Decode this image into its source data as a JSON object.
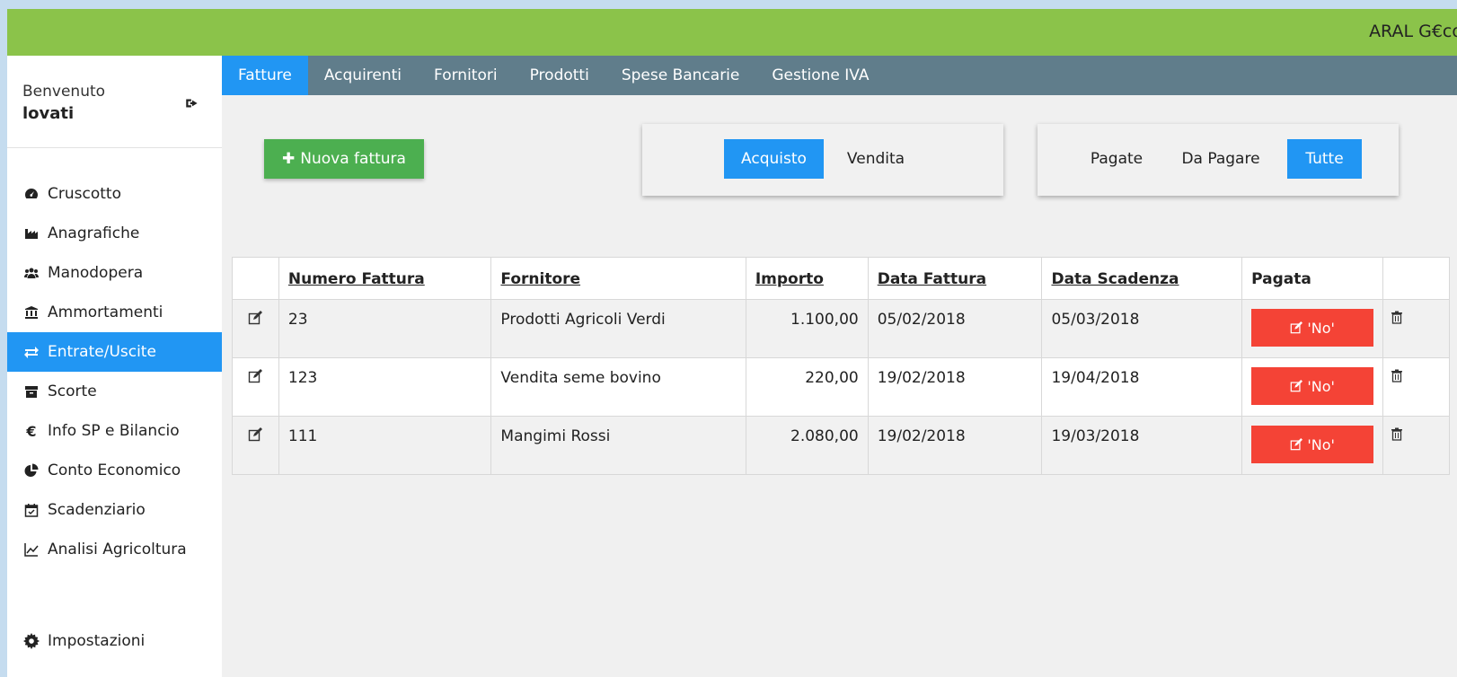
{
  "app": {
    "brand": "ARAL G€co"
  },
  "user": {
    "welcome": "Benvenuto",
    "name": "lovati"
  },
  "sidebar": {
    "items": [
      {
        "label": "Cruscotto",
        "icon": "dashboard-icon"
      },
      {
        "label": "Anagrafiche",
        "icon": "industry-icon"
      },
      {
        "label": "Manodopera",
        "icon": "users-icon"
      },
      {
        "label": "Ammortamenti",
        "icon": "bank-icon"
      },
      {
        "label": "Entrate/Uscite",
        "icon": "exchange-icon",
        "active": true
      },
      {
        "label": "Scorte",
        "icon": "archive-icon"
      },
      {
        "label": "Info SP e Bilancio",
        "icon": "euro-icon"
      },
      {
        "label": "Conto Economico",
        "icon": "pie-chart-icon"
      },
      {
        "label": "Scadenziario",
        "icon": "calendar-check-icon"
      },
      {
        "label": "Analisi Agricoltura",
        "icon": "line-chart-icon"
      }
    ],
    "settings": {
      "label": "Impostazioni",
      "icon": "gear-icon"
    }
  },
  "tabs": [
    {
      "label": "Fatture",
      "active": true
    },
    {
      "label": "Acquirenti"
    },
    {
      "label": "Fornitori"
    },
    {
      "label": "Prodotti"
    },
    {
      "label": "Spese Bancarie"
    },
    {
      "label": "Gestione IVA"
    }
  ],
  "actions": {
    "new_invoice": "Nuova fattura"
  },
  "type_filter": {
    "purchase": "Acquisto",
    "sale": "Vendita",
    "selected": "Acquisto"
  },
  "payment_filter": {
    "paid": "Pagate",
    "to_pay": "Da Pagare",
    "all": "Tutte",
    "selected": "Tutte"
  },
  "table": {
    "headers": {
      "number": "Numero Fattura",
      "supplier": "Fornitore",
      "amount": "Importo",
      "invoice_date": "Data Fattura",
      "due_date": "Data Scadenza",
      "paid": "Pagata"
    },
    "rows": [
      {
        "number": "23",
        "supplier": "Prodotti Agricoli Verdi",
        "amount": "1.100,00",
        "invoice_date": "05/02/2018",
        "due_date": "05/03/2018",
        "paid": "'No'"
      },
      {
        "number": "123",
        "supplier": "Vendita seme bovino",
        "amount": "220,00",
        "invoice_date": "19/02/2018",
        "due_date": "19/04/2018",
        "paid": "'No'"
      },
      {
        "number": "111",
        "supplier": "Mangimi Rossi",
        "amount": "2.080,00",
        "invoice_date": "19/02/2018",
        "due_date": "19/03/2018",
        "paid": "'No'"
      }
    ]
  },
  "colors": {
    "topbar": "#8bc34a",
    "navbar": "#607d8b",
    "accent": "#2196f3",
    "success": "#4caf50",
    "danger": "#f44336"
  }
}
